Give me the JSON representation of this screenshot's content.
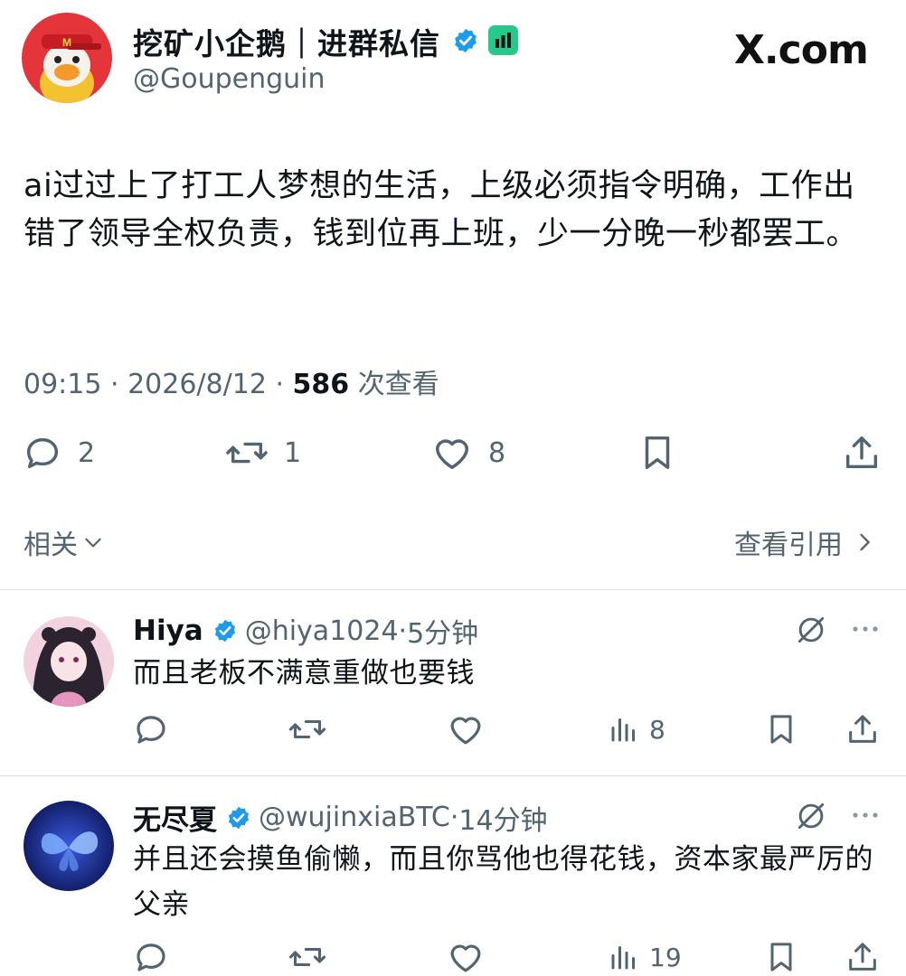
{
  "colors": {
    "text": "#0f1419",
    "secondary": "#536471",
    "verified": "#1d9bf0",
    "badge": "#27c98a"
  },
  "site": {
    "watermark": "X.com"
  },
  "post": {
    "author": {
      "name": "挖矿小企鹅｜进群私信",
      "handle": "@Goupenguin",
      "verified": true,
      "avatar_icon": "penguin-avatar-icon",
      "badge_icon": "bar-chart-badge-icon"
    },
    "text": "ai过过上了打工人梦想的生活，上级必须指令明确，工作出错了领导全权负责，钱到位再上班，少一分晚一秒都罢工。",
    "time": "09:15",
    "date": "2026/8/12",
    "views": "586",
    "views_label": "次查看",
    "actions": {
      "replies": "2",
      "reposts": "1",
      "likes": "8"
    }
  },
  "section": {
    "related_label": "相关",
    "view_quotes_label": "查看引用"
  },
  "replies": [
    {
      "name": "Hiya",
      "handle": "@hiya1024",
      "time": "5分钟",
      "text": "而且老板不满意重做也要钱",
      "views": "8",
      "verified": true
    },
    {
      "name": "无尽夏",
      "handle": "@wujinxiaBTC",
      "time": "14分钟",
      "text": "并且还会摸鱼偷懒，而且你骂他也得花钱，资本家最严厉的父亲",
      "views": "19",
      "verified": true
    }
  ]
}
